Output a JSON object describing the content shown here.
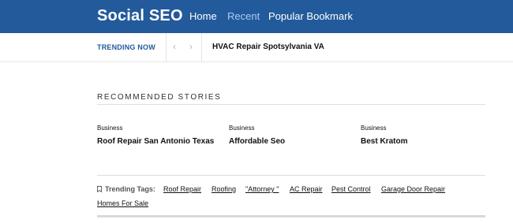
{
  "brand": {
    "name": "Social SEO",
    "colors": {
      "header_bg": "#235a9b",
      "nav_active": "#a9cdf3",
      "trending_accent": "#235a9b"
    }
  },
  "nav": {
    "items": [
      {
        "label": "Home",
        "active": false
      },
      {
        "label": "Recent",
        "active": true
      },
      {
        "label": "Popular Bookmark",
        "active": false
      }
    ]
  },
  "trending": {
    "label": "TRENDING NOW",
    "prev_icon": "chevron-left-icon",
    "next_icon": "chevron-right-icon",
    "headline": "HVAC Repair Spotsylvania VA"
  },
  "recommended": {
    "title": "RECOMMENDED STORIES",
    "stories": [
      {
        "category": "Business",
        "title": "Roof Repair San Antonio Texas"
      },
      {
        "category": "Business",
        "title": "Affordable Seo"
      },
      {
        "category": "Business",
        "title": "Best Kratom"
      }
    ]
  },
  "tags": {
    "label": "Trending Tags:",
    "icon": "bookmark-icon",
    "items": [
      "Roof Repair",
      "Roofing",
      "\"Attorney \"",
      "AC Repair",
      "Pest Control",
      "Garage Door Repair",
      "Homes For Sale"
    ]
  }
}
